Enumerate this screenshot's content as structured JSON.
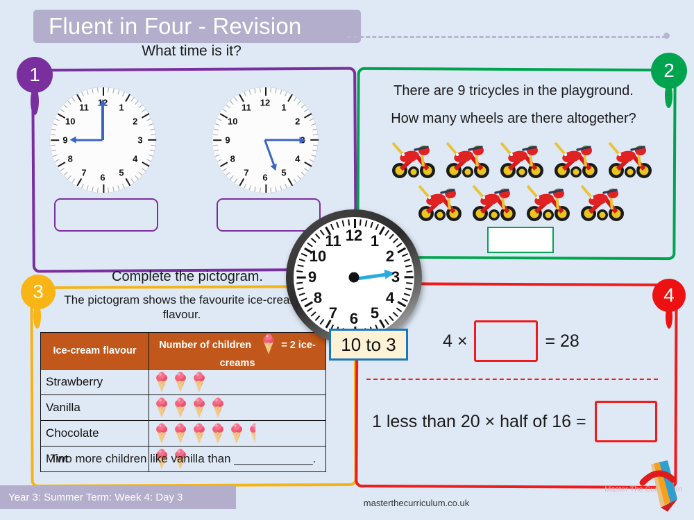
{
  "header": {
    "title": "Fluent in Four - Revision"
  },
  "footer": {
    "term_label": "Year 3: Summer Term: Week 4: Day 3",
    "site_url": "masterthecurriculum.co.uk",
    "brand": "Master The Curriculum"
  },
  "center_clock": {
    "label": "10 to 3",
    "hand_points_to": "3",
    "numbers": [
      "1",
      "2",
      "3",
      "4",
      "5",
      "6",
      "7",
      "8",
      "9",
      "10",
      "11",
      "12"
    ]
  },
  "questions": [
    {
      "number": "1",
      "color": "#7a2f9e",
      "prompt": "What time is it?",
      "clocks": [
        {
          "name": "clock-a",
          "hour_angle": 270,
          "minute_angle": 0,
          "numbers": [
            "1",
            "2",
            "3",
            "4",
            "5",
            "6",
            "7",
            "8",
            "9",
            "10",
            "11",
            "12"
          ]
        },
        {
          "name": "clock-b",
          "hour_angle": 160,
          "minute_angle": 90,
          "numbers": [
            "1",
            "2",
            "3",
            "4",
            "5",
            "6",
            "7",
            "8",
            "9",
            "10",
            "11",
            "12"
          ]
        }
      ],
      "answer_boxes": [
        "",
        ""
      ]
    },
    {
      "number": "2",
      "color": "#00a44f",
      "line1": "There are 9 tricycles in the playground.",
      "line2": "How many wheels are there altogether?",
      "tricycle_count": 9,
      "answer_box": ""
    },
    {
      "number": "3",
      "color": "#f9b515",
      "title": "Complete the pictogram.",
      "subtitle": "The pictogram shows the favourite ice-cream flavour.",
      "footer_sentence": "Two more children like vanilla than ____________.",
      "table": {
        "headers": [
          "Ice-cream flavour",
          "Number of children",
          "= 2 ice-creams"
        ],
        "key_icon": "ice-cream-cone-icon",
        "header_bg": "#c1571a",
        "rows": [
          {
            "flavour": "Strawberry",
            "cones": 3,
            "half_cone": false
          },
          {
            "flavour": "Vanilla",
            "cones": 4,
            "half_cone": false
          },
          {
            "flavour": "Chocolate",
            "cones": 5,
            "half_cone": true
          },
          {
            "flavour": "Mint",
            "cones": 2,
            "half_cone": false
          }
        ]
      }
    },
    {
      "number": "4",
      "color": "#ee1111",
      "row1": {
        "prefix": "4 ×",
        "suffix": "= 28"
      },
      "row2": {
        "prefix": "1 less than 20 × half of 16 =",
        "suffix": ""
      }
    }
  ]
}
